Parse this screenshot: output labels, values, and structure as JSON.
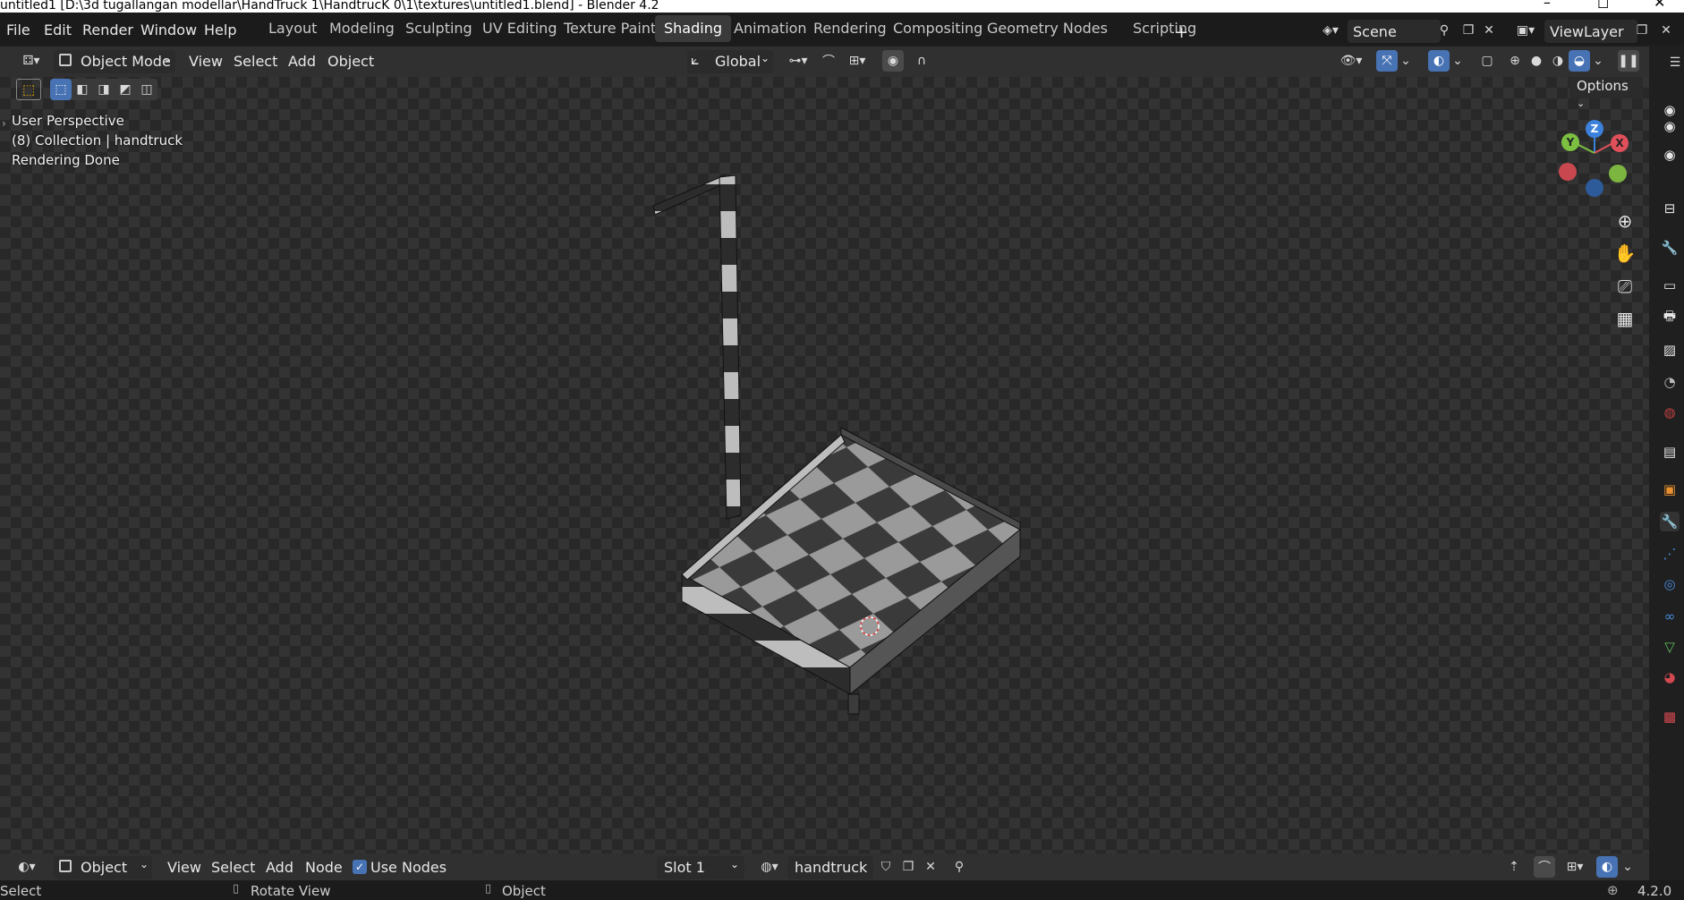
{
  "window": {
    "title": "untitled1 [D:\\3d tugallangan modellar\\HandTruck 1\\HandtrucK 0\\1\\textures\\untitled1.blend] - Blender 4.2",
    "minimize": "–",
    "maximize": "◻",
    "close": "✕"
  },
  "menu": [
    "File",
    "Edit",
    "Render",
    "Window",
    "Help"
  ],
  "workspaces": [
    "Layout",
    "Modeling",
    "Sculpting",
    "UV Editing",
    "Texture Paint",
    "Shading",
    "Animation",
    "Rendering",
    "Compositing",
    "Geometry Nodes",
    "Scripting"
  ],
  "active_workspace": "Shading",
  "add_workspace": "+",
  "scene": {
    "name": "Scene"
  },
  "view_layer": {
    "name": "ViewLayer"
  },
  "viewport_header": {
    "mode": "Object Mode",
    "menus": [
      "View",
      "Select",
      "Add",
      "Object"
    ],
    "transform_orientation": "Global",
    "options_label": "Options"
  },
  "viewport_overlay": {
    "perspective": "User Perspective",
    "collection": "(8) Collection | handtruck",
    "status": "Rendering Done"
  },
  "gizmo": {
    "z": "Z",
    "y": "Y",
    "x": "X"
  },
  "shader_header": {
    "type": "Object",
    "menus": [
      "View",
      "Select",
      "Add",
      "Node"
    ],
    "use_nodes_label": "Use Nodes",
    "use_nodes_checked": true,
    "slot": "Slot 1",
    "material": "handtruck"
  },
  "statusbar": {
    "select": "Select",
    "rotate": "Rotate View",
    "object": "Object",
    "version": "4.2.0"
  },
  "colors": {
    "accent": "#4772b3",
    "axis_x": "#e0505a",
    "axis_y": "#7cc042",
    "axis_z": "#3c82dc"
  }
}
